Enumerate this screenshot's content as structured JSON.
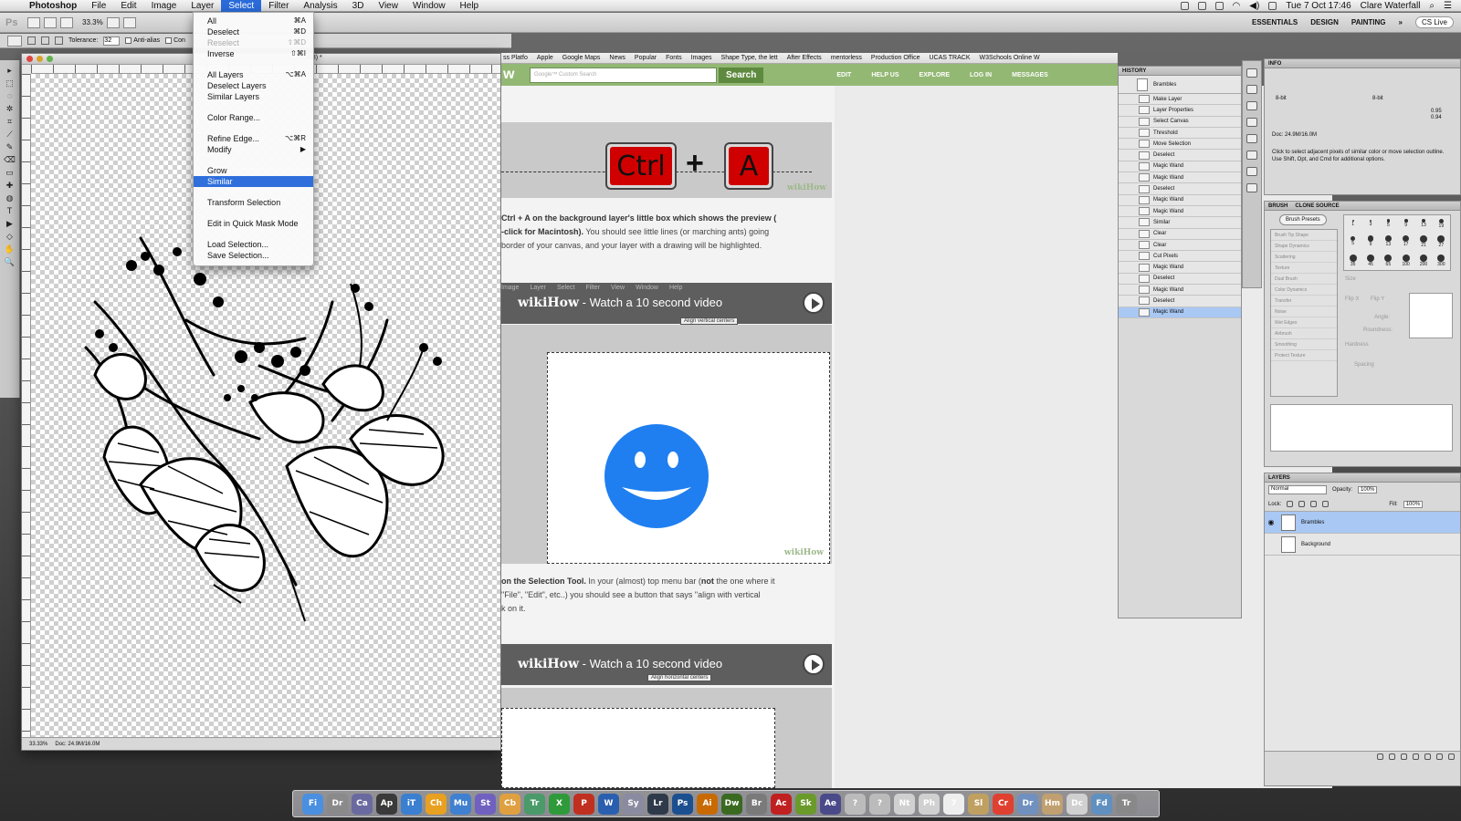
{
  "menubar": {
    "app_name": "Photoshop",
    "menus": [
      "File",
      "Edit",
      "Image",
      "Layer",
      "Select",
      "Filter",
      "Analysis",
      "3D",
      "View",
      "Window",
      "Help"
    ],
    "active_menu": "Select",
    "clock": "Tue 7 Oct  17:46",
    "user": "Clare Waterfall"
  },
  "optionsbar": {
    "ps_label": "Ps",
    "zoom": "33.3%",
    "workspaces": [
      "ESSENTIALS",
      "DESIGN",
      "PAINTING"
    ],
    "cs_live": "CS Live"
  },
  "tool_options": {
    "tolerance_label": "Tolerance:",
    "tolerance_value": "32",
    "anti_alias": "Anti-alias",
    "contiguous": "Con"
  },
  "tools": [
    "▸",
    "⬚",
    "◌",
    "✲",
    "⌗",
    "⟋",
    "✎",
    "⌫",
    "▭",
    "✚",
    "◍",
    "T",
    "▶",
    "◇",
    "✋",
    "🔍"
  ],
  "select_menu": {
    "items": [
      {
        "label": "All",
        "shortcut": "⌘A",
        "disabled": false
      },
      {
        "label": "Deselect",
        "shortcut": "⌘D",
        "disabled": false
      },
      {
        "label": "Reselect",
        "shortcut": "⇧⌘D",
        "disabled": true
      },
      {
        "label": "Inverse",
        "shortcut": "⇧⌘I",
        "disabled": false
      },
      {
        "label": "All Layers",
        "shortcut": "⌥⌘A",
        "disabled": false
      },
      {
        "label": "Deselect Layers",
        "shortcut": "",
        "disabled": false
      },
      {
        "label": "Similar Layers",
        "shortcut": "",
        "disabled": false
      },
      {
        "label": "Color Range...",
        "shortcut": "",
        "disabled": false
      },
      {
        "label": "Refine Edge...",
        "shortcut": "⌥⌘R",
        "disabled": false
      },
      {
        "label": "Modify",
        "shortcut": "▶",
        "disabled": false
      },
      {
        "label": "Grow",
        "shortcut": "",
        "disabled": false
      },
      {
        "label": "Similar",
        "shortcut": "",
        "disabled": false
      },
      {
        "label": "Transform Selection",
        "shortcut": "",
        "disabled": false
      },
      {
        "label": "Edit in Quick Mask Mode",
        "shortcut": "",
        "disabled": false
      },
      {
        "label": "Load Selection...",
        "shortcut": "",
        "disabled": false
      },
      {
        "label": "Save Selection...",
        "shortcut": "",
        "disabled": false
      }
    ],
    "highlighted": "Similar"
  },
  "document": {
    "title_fragment": "8/8) *",
    "zoom": "33.33%",
    "doc_size": "Doc: 24.9M/16.0M"
  },
  "browser": {
    "bookmarks": [
      "ss Platfo",
      "Apple",
      "Google Maps",
      "News",
      "Popular",
      "Fonts",
      "Images",
      "Shape Type, the lett",
      "After Effects",
      "mentorless",
      "Production Office",
      "UCAS TRACK",
      "W3Schools Online W"
    ],
    "logo": "w",
    "search_placeholder": "Google™ Custom Search",
    "search_button": "Search",
    "nav": [
      "EDIT",
      "HELP US",
      "EXPLORE",
      "LOG IN",
      "MESSAGES"
    ],
    "keys": {
      "ctrl": "Ctrl",
      "plus": "+",
      "a": "A"
    },
    "wikihow_mark": "wikiHow",
    "step1_bold": "Ctrl + A on the background layer's little box which shows the preview (",
    "step1_bold2": "-click for Macintosh).",
    "step1_text": " You should see little lines (or marching ants) going",
    "step1_line3": "border of your canvas, and your layer with a drawing will be highlighted.",
    "video_brand": "wikiHow",
    "video_text": " - Watch a 10 second video",
    "tooltip1": "Align vertical centers",
    "tooltip2": "Align horizontal centers",
    "step2_bold": "on the Selection Tool.",
    "step2_text": " In your (almost) top menu bar (",
    "step2_not": "not",
    "step2_text2": " the one where it",
    "step2_line2": "\"File\", \"Edit\", etc..) you should see a button that says \"align with vertical",
    "step2_line3": "k on it.",
    "video_menu": [
      "Image",
      "Layer",
      "Select",
      "Filter",
      "View",
      "Window",
      "Help"
    ]
  },
  "history": {
    "title": "HISTORY",
    "snapshot": "Brambles",
    "steps": [
      "Make Layer",
      "Layer Properties",
      "Select Canvas",
      "Threshold",
      "Move Selection",
      "Deselect",
      "Magic Wand",
      "Magic Wand",
      "Deselect",
      "Magic Wand",
      "Magic Wand",
      "Similar",
      "Clear",
      "Clear",
      "Cut Pixels",
      "Magic Wand",
      "Deselect",
      "Magic Wand",
      "Deselect",
      "Magic Wand"
    ],
    "active_step": "Magic Wand"
  },
  "info": {
    "title": "INFO",
    "depth": "8-bit",
    "w": "0.95",
    "h": "0.94",
    "doc": "Doc: 24.9M/16.0M",
    "hint": "Click to select adjacent pixels of similar color or move selection outline. Use Shift, Opt, and Cmd for additional options."
  },
  "brush": {
    "tabs": [
      "BRUSH",
      "CLONE SOURCE"
    ],
    "presets_button": "Brush Presets",
    "options": [
      "Brush Tip Shape",
      "Shape Dynamics",
      "Scattering",
      "Texture",
      "Dual Brush",
      "Color Dynamics",
      "Transfer",
      "Noise",
      "Wet Edges",
      "Airbrush",
      "Smoothing",
      "Protect Texture"
    ],
    "sizes": [
      "1",
      "3",
      "5",
      "9",
      "13",
      "19",
      "5",
      "9",
      "13",
      "17",
      "21",
      "27",
      "35",
      "45",
      "65",
      "100",
      "200",
      "300"
    ],
    "labels": {
      "size": "Size",
      "flipx": "Flip X",
      "flipy": "Flip Y",
      "angle": "Angle:",
      "roundness": "Roundness:",
      "hardness": "Hardness",
      "spacing": "Spacing"
    }
  },
  "layers": {
    "title": "LAYERS",
    "blend": "Normal",
    "opacity_label": "Opacity:",
    "opacity": "100%",
    "lock_label": "Lock:",
    "fill_label": "Fill:",
    "fill": "100%",
    "items": [
      {
        "name": "Brambles",
        "active": true
      },
      {
        "name": "Background",
        "active": false
      }
    ]
  },
  "dock": [
    "Fi",
    "Dr",
    "Ca",
    "Ap",
    "iT",
    "Ch",
    "Mu",
    "St",
    "Cb",
    "Tr",
    "X",
    "P",
    "W",
    "Sy",
    "Lr",
    "Ps",
    "Ai",
    "Dw",
    "Br",
    "Ac",
    "Sk",
    "Ae",
    "?",
    "?",
    "Nt",
    "Ph",
    "7",
    "Sl",
    "Cr",
    "Dr",
    "Hm",
    "Dc",
    "Fd",
    "Tr"
  ],
  "colors": {
    "accent": "#2f6fdc",
    "wiki_green": "#93b874",
    "key_red": "#d10000",
    "smiley_blue": "#1f7ff0"
  }
}
